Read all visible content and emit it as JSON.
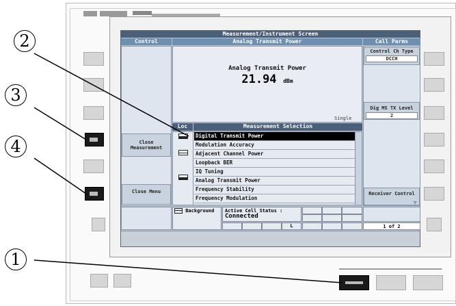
{
  "title": "Measurement/Instrument Screen",
  "control": {
    "header": "Control"
  },
  "measurement": {
    "header": "Analog Transmit Power",
    "name": "Analog Transmit Power",
    "value": "21.94",
    "unit": "dBm",
    "mode": "Single"
  },
  "call_parms": {
    "header": "Call Parms",
    "control_ch_type_label": "Control Ch Type",
    "control_ch_type_value": "DCCH",
    "dig_ms_tx_level_label": "Dig MS TX Level",
    "dig_ms_tx_level_value": "2",
    "receiver_control_label": "Receiver Control",
    "page_indicator": "1 of 2"
  },
  "softkeys_left": {
    "close_measurement": "Close Measurement",
    "close_menu": "Close Menu"
  },
  "selection": {
    "loc_header": "Loc",
    "header": "Measurement Selection",
    "items": [
      "Digital Transmit Power",
      "Modulation Accuracy",
      "Adjacent Channel Power",
      "Loopback BER",
      "IQ Tuning",
      "Analog Transmit Power",
      "Frequency Stability",
      "Frequency Modulation"
    ]
  },
  "status": {
    "background_label": "Background",
    "active_cell_label": "Active Cell Status :",
    "active_cell_value": "Connected",
    "indicator_l": "L"
  },
  "callouts": [
    "1",
    "2",
    "3",
    "4"
  ]
}
